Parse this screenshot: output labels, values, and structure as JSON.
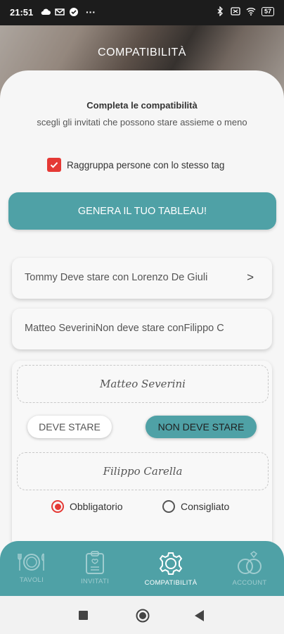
{
  "status_bar": {
    "time": "21:51",
    "battery": "57"
  },
  "header": {
    "title": "COMPATIBILITÀ"
  },
  "intro": {
    "title": "Completa le compatibilità",
    "subtitle": "scegli gli invitati che possono stare assieme o meno"
  },
  "group_by_tag": {
    "label": "Raggruppa persone con lo stesso tag",
    "checked": true
  },
  "generate_button": {
    "label": "GENERA IL TUO TABLEAU!"
  },
  "rules": [
    {
      "text": "Tommy  Deve stare con Lorenzo De Giuli",
      "chevron": ">"
    },
    {
      "text": "Matteo SeveriniNon deve stare conFilippo C"
    }
  ],
  "editor": {
    "person_a": "Matteo Severini",
    "person_b": "Filippo Carella",
    "option_must": "DEVE STARE",
    "option_must_not": "NON DEVE STARE",
    "selected_option": "NON DEVE STARE",
    "radio_mandatory": "Obbligatorio",
    "radio_suggested": "Consigliato",
    "selected_radio": "Obbligatorio"
  },
  "bottom_nav": {
    "items": [
      {
        "label": "TAVOLI",
        "icon": "dining-icon"
      },
      {
        "label": "INVITATI",
        "icon": "clipboard-icon"
      },
      {
        "label": "COMPATIBILITÀ",
        "icon": "gear-icon"
      },
      {
        "label": "ACCOUNT",
        "icon": "rings-icon"
      }
    ],
    "active": "COMPATIBILITÀ"
  },
  "colors": {
    "accent": "#4fa1a6",
    "checkbox": "#e53935",
    "radio_selected": "#e53935"
  }
}
